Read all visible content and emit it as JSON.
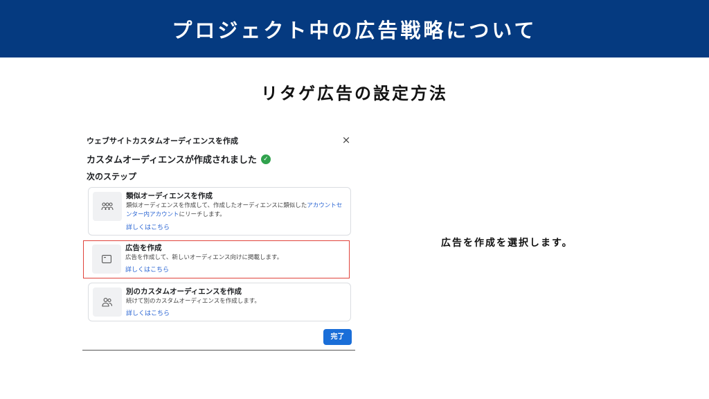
{
  "header": {
    "title": "プロジェクト中の広告戦略について"
  },
  "section": {
    "title": "リタゲ広告の設定方法"
  },
  "dialog": {
    "title": "ウェブサイトカスタムオーディエンスを作成",
    "close_label": "×",
    "status_text": "カスタムオーディエンスが作成されました",
    "next_steps_label": "次のステップ",
    "options": [
      {
        "title": "類似オーディエンスを作成",
        "desc_pre": "類似オーディエンスを作成して、作成したオーディエンスに類似した",
        "desc_link": "アカウントセンター内アカウント",
        "desc_post": "にリーチします。",
        "learn_more": "詳しくはこちら",
        "icon": "people-group-icon"
      },
      {
        "title": "広告を作成",
        "desc_pre": "広告を作成して、新しいオーディエンス向けに掲載します。",
        "learn_more": "詳しくはこちら",
        "icon": "ad-window-icon"
      },
      {
        "title": "別のカスタムオーディエンスを作成",
        "desc_pre": "続けて別のカスタムオーディエンスを作成します。",
        "learn_more": "詳しくはこちら",
        "icon": "people-pair-icon"
      }
    ],
    "done_label": "完了"
  },
  "side_note": {
    "text": "広告を作成を選択します。"
  },
  "colors": {
    "header_bg": "#053a80",
    "link": "#2a65d3",
    "primary_button": "#1a6ed8",
    "highlight": "#e0423a",
    "success": "#30a24d"
  }
}
